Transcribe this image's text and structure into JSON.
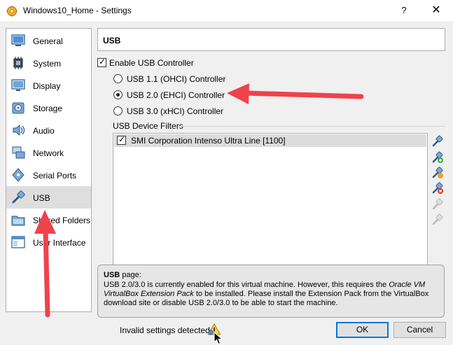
{
  "window": {
    "title": "Windows10_Home - Settings",
    "help_label": "?",
    "close_label": "✕"
  },
  "sidebar": {
    "items": [
      {
        "label": "General",
        "icon": "general-icon"
      },
      {
        "label": "System",
        "icon": "system-icon"
      },
      {
        "label": "Display",
        "icon": "display-icon"
      },
      {
        "label": "Storage",
        "icon": "storage-icon"
      },
      {
        "label": "Audio",
        "icon": "audio-icon"
      },
      {
        "label": "Network",
        "icon": "network-icon"
      },
      {
        "label": "Serial Ports",
        "icon": "serial-ports-icon"
      },
      {
        "label": "USB",
        "icon": "usb-icon",
        "selected": true
      },
      {
        "label": "Shared Folders",
        "icon": "shared-folders-icon"
      },
      {
        "label": "User Interface",
        "icon": "user-interface-icon"
      }
    ]
  },
  "page": {
    "title": "USB",
    "enable_usb_label": "Enable USB Controller",
    "enable_usb_checked": true,
    "radios": [
      {
        "label": "USB 1.1 (OHCI) Controller",
        "checked": false
      },
      {
        "label": "USB 2.0 (EHCI) Controller",
        "checked": true
      },
      {
        "label": "USB 3.0 (xHCI) Controller",
        "checked": false
      }
    ],
    "filters_title": "USB Device Filters",
    "filters": [
      {
        "label": "SMI Corporation Intenso Ultra Line [1100]",
        "checked": true
      }
    ],
    "filter_tools": [
      "add-empty-filter-icon",
      "add-filter-from-device-icon",
      "edit-filter-icon",
      "remove-filter-icon",
      "move-filter-up-icon",
      "move-filter-down-icon"
    ]
  },
  "info": {
    "title": "USB",
    "title_suffix": " page:",
    "line1_a": "USB 2.0/3.0 is currently enabled for this virtual machine. However, this requires the ",
    "line1_em": "Oracle VM VirtualBox Extension Pack",
    "line1_b": " to be installed. Please install the Extension Pack from the VirtualBox download site or disable USB 2.0/3.0 to be able to start the machine."
  },
  "footer": {
    "invalid_text": "Invalid settings detected",
    "ok_label": "OK",
    "cancel_label": "Cancel"
  },
  "colors": {
    "annotation_arrow": "#f0424a",
    "selected_item": "#dedede",
    "ok_border": "#0078d7"
  }
}
